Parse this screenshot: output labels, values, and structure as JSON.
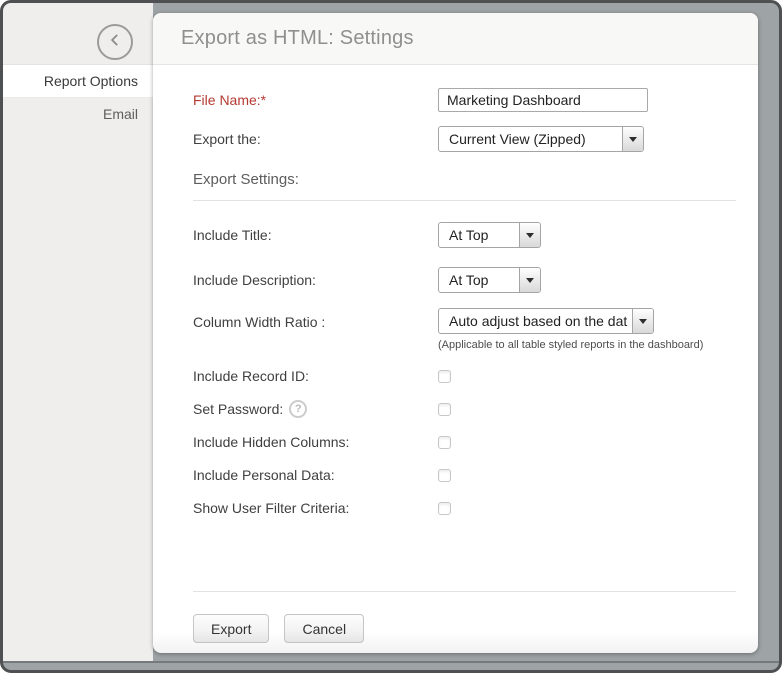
{
  "window": {
    "title": "Export as HTML: Settings"
  },
  "sidebar": {
    "items": [
      {
        "label": "Report Options",
        "active": true
      },
      {
        "label": "Email",
        "active": false
      }
    ]
  },
  "form": {
    "file_name": {
      "label": "File Name:*",
      "value": "Marketing Dashboard"
    },
    "export_the": {
      "label": "Export the:",
      "value": "Current View (Zipped)"
    },
    "section_title": "Export Settings:",
    "include_title": {
      "label": "Include Title:",
      "value": "At Top"
    },
    "include_description": {
      "label": "Include Description:",
      "value": "At Top"
    },
    "column_width_ratio": {
      "label": "Column Width Ratio :",
      "value": "Auto adjust based on the dat",
      "note": "(Applicable to all table styled reports in the dashboard)"
    },
    "help_icon": "?",
    "checkboxes": [
      {
        "label": "Include Record ID:",
        "checked": false
      },
      {
        "label": "Set Password:",
        "checked": false
      },
      {
        "label": "Include Hidden Columns:",
        "checked": false
      },
      {
        "label": "Include Personal Data:",
        "checked": false
      },
      {
        "label": "Show User Filter Criteria:",
        "checked": false
      }
    ],
    "buttons": {
      "export": "Export",
      "cancel": "Cancel"
    }
  },
  "colors": {
    "required_label": "#b43a32",
    "window_background": "#9ea3a5",
    "frame_border": "#4e5052",
    "sidebar_background": "#efeeec",
    "header_background": "#f8f8f7"
  }
}
